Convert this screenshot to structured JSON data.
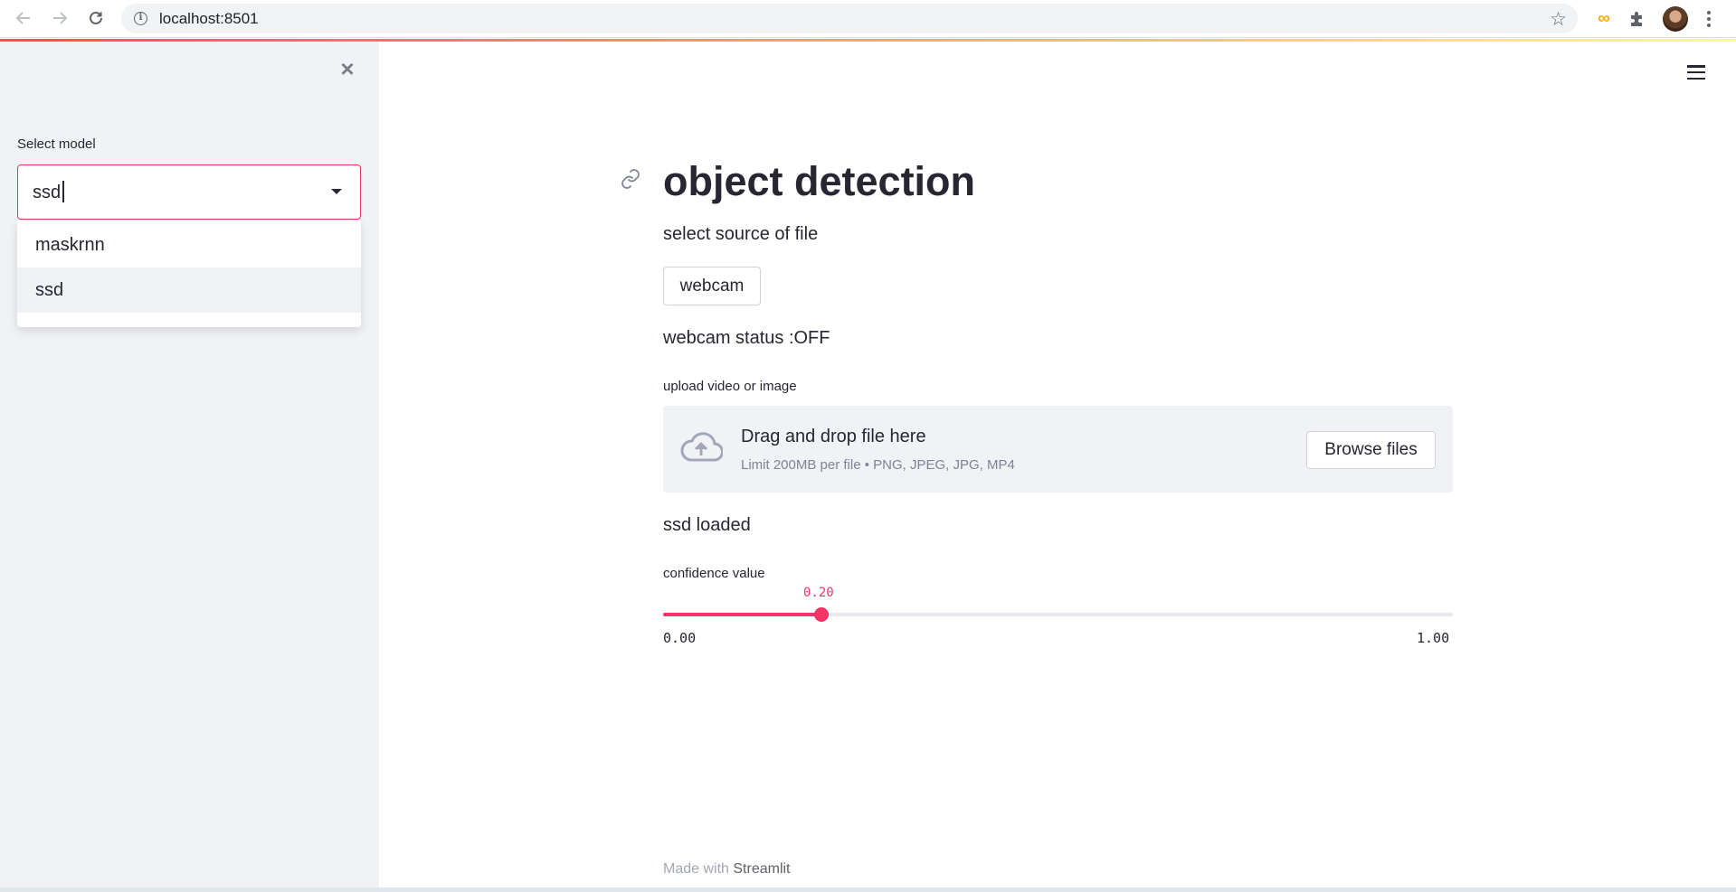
{
  "browser": {
    "url": "localhost:8501",
    "icons": [
      "back-arrow-icon",
      "forward-arrow-icon",
      "reload-icon",
      "info-icon",
      "star-icon",
      "colab-icon",
      "puzzle-icon",
      "avatar",
      "kebab-icon"
    ]
  },
  "sidebar": {
    "close_icon": "×",
    "select_label": "Select model",
    "select_value": "ssd",
    "options": [
      "maskrnn",
      "ssd"
    ]
  },
  "main": {
    "title": "object detection",
    "source_label": "select source of file",
    "webcam_button": "webcam",
    "webcam_status": "webcam status :OFF",
    "upload_label": "upload video or image",
    "uploader": {
      "drag_text": "Drag and drop file here",
      "limit_text": "Limit 200MB per file • PNG, JPEG, JPG, MP4",
      "browse_label": "Browse files"
    },
    "model_status": "ssd loaded",
    "slider": {
      "label": "confidence value",
      "value": 0.2,
      "value_text": "0.20",
      "min": 0,
      "max": 1,
      "min_text": "0.00",
      "max_text": "1.00"
    }
  },
  "footer": {
    "prefix": "Made with",
    "link": "Streamlit"
  },
  "colors": {
    "accent": "#f63366",
    "focus_border": "#e8365d",
    "sidebar_bg": "#f0f2f6",
    "text": "#262730"
  }
}
